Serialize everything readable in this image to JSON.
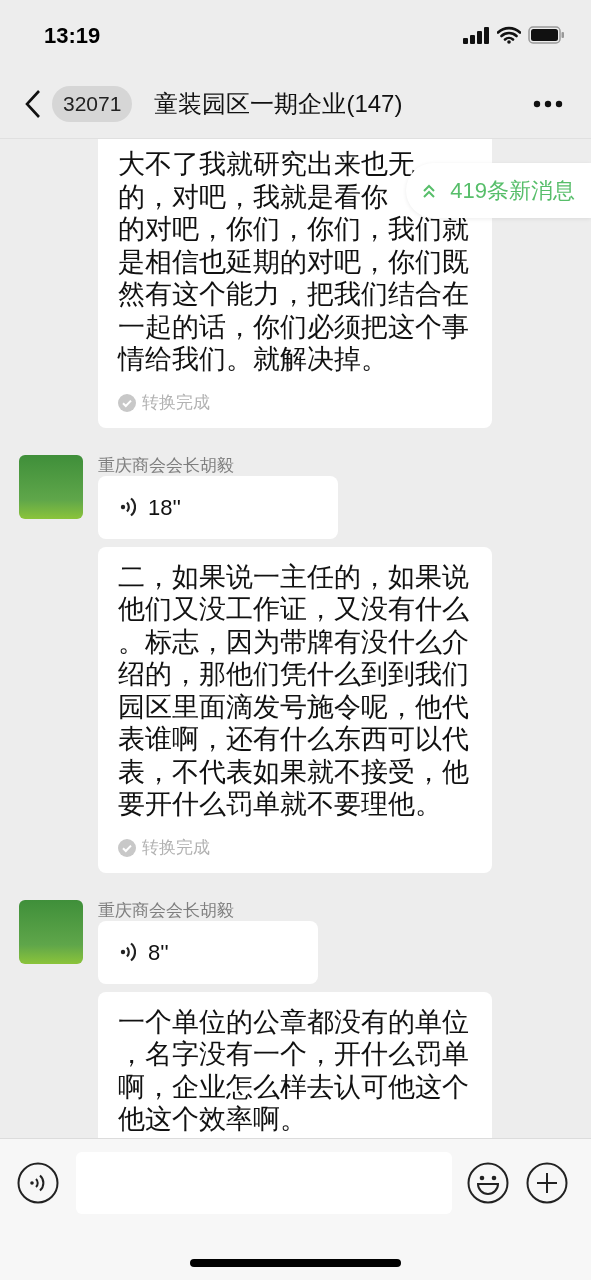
{
  "status_bar": {
    "time": "13:19"
  },
  "header": {
    "unread_count": "32071",
    "title": "童装园区一期企业(147)"
  },
  "new_messages_badge": "419条新消息",
  "messages": [
    {
      "kind": "transcript",
      "lines": [
        "大不了我就研究出来也无",
        "的，对吧，我就是看你",
        "的对吧，你们，你们，我们就",
        "是相信也延期的对吧，你们既",
        "然有这个能力，把我们结合在",
        "一起的话，你们必须把这个事",
        "情给我们。就解决掉。"
      ],
      "status": "转换完成"
    },
    {
      "kind": "voice",
      "sender": "重庆商会会长胡毅",
      "duration": "18''"
    },
    {
      "kind": "transcript",
      "text": "二，如果说一主任的，如果说他们又没工作证，又没有什么。标志，因为带牌有没什么介绍的，那他们凭什么到到我们园区里面滴发号施令呢，他代表谁啊，还有什么东西可以代表，不代表如果就不接受，他要开什么罚单就不要理他。",
      "status": "转换完成"
    },
    {
      "kind": "voice",
      "sender": "重庆商会会长胡毅",
      "duration": "8''"
    },
    {
      "kind": "transcript",
      "text": "一个单位的公章都没有的单位，名字没有一个，开什么罚单啊，企业怎么样去认可他这个他这个效率啊。"
    }
  ]
}
